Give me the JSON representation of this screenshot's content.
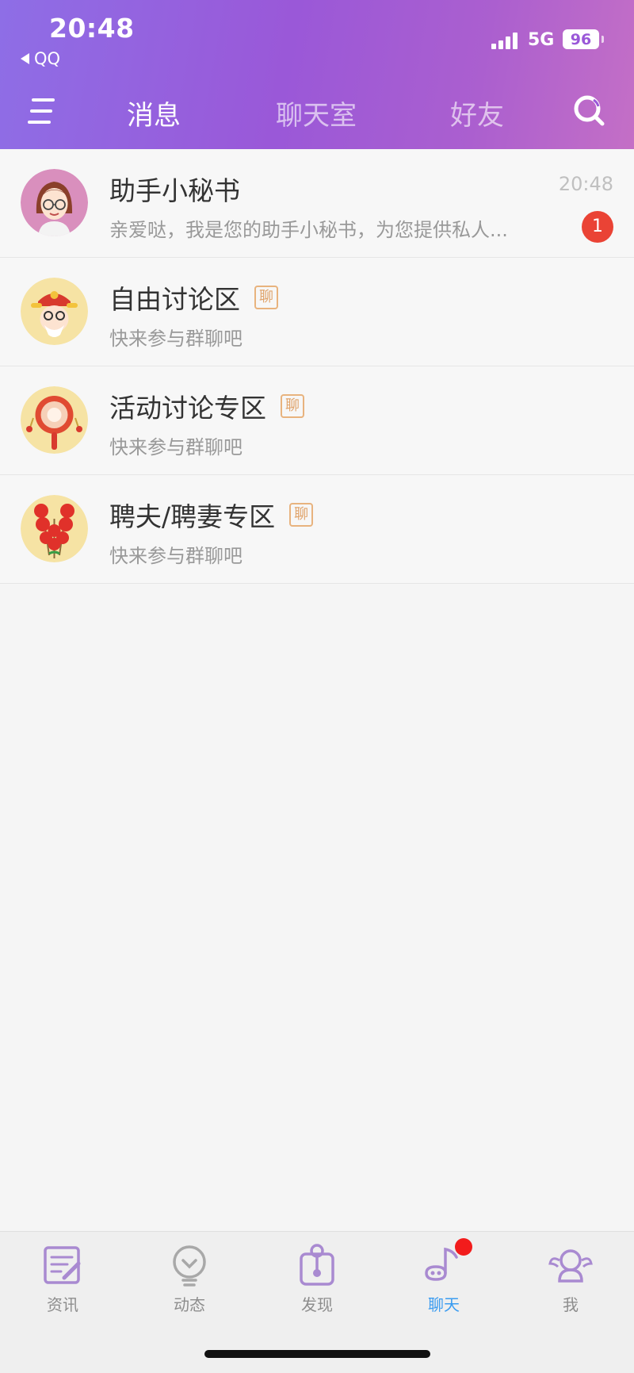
{
  "status_bar": {
    "time": "20:48",
    "back_app": "QQ",
    "network": "5G",
    "battery": "96"
  },
  "header": {
    "tabs": [
      {
        "label": "消息",
        "active": true
      },
      {
        "label": "聊天室",
        "active": false
      },
      {
        "label": "好友",
        "active": false
      }
    ]
  },
  "conversations": [
    {
      "title": "助手小秘书",
      "subtitle": "亲爱哒，我是您的助手小秘书，为您提供私人...",
      "time": "20:48",
      "unread": "1",
      "avatar": "assistant-avatar-icon"
    },
    {
      "title": "自由讨论区",
      "subtitle": "快来参与群聊吧",
      "tag": "聊",
      "avatar": "god-of-wealth-avatar-icon"
    },
    {
      "title": "活动讨论专区",
      "subtitle": "快来参与群聊吧",
      "tag": "聊",
      "avatar": "rattle-drum-avatar-icon"
    },
    {
      "title": "聘夫/聘妻专区",
      "subtitle": "快来参与群聊吧",
      "tag": "聊",
      "avatar": "candied-haws-avatar-icon"
    }
  ],
  "tabbar": {
    "items": [
      {
        "label": "资讯",
        "icon": "news-icon",
        "active": false
      },
      {
        "label": "动态",
        "icon": "moments-icon",
        "active": false
      },
      {
        "label": "发现",
        "icon": "discover-icon",
        "active": false
      },
      {
        "label": "聊天",
        "icon": "chat-icon",
        "active": true,
        "badge_dot": true
      },
      {
        "label": "我",
        "icon": "profile-icon",
        "active": false
      }
    ]
  },
  "colors": {
    "header_gradient_start": "#8e6ee6",
    "header_gradient_end": "#c46fc6",
    "accent_blue": "#3b9cf0",
    "unread_red": "#ea4335",
    "tag_orange": "#e0a36a",
    "icon_purple": "#a98ad1"
  }
}
